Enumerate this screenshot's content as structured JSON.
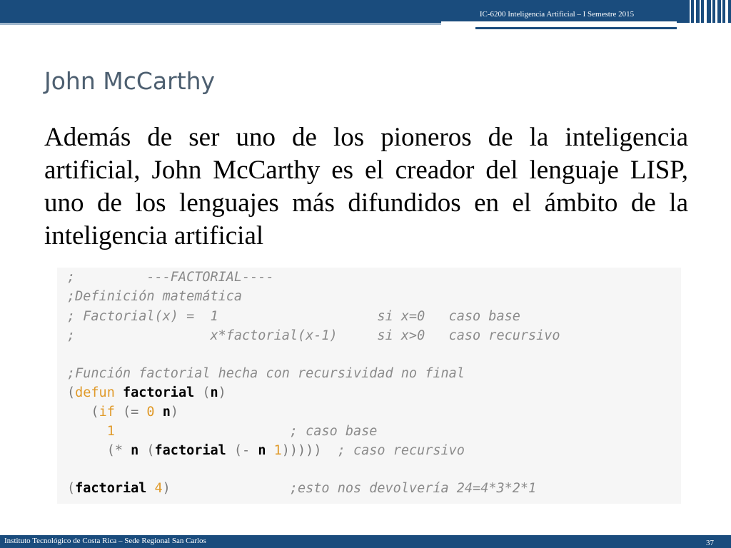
{
  "header": {
    "course": "IC-6200 Inteligencia Artificial – I Semestre 2015"
  },
  "slide": {
    "title": "John McCarthy",
    "paragraph": "Además de ser uno de los pioneros de la inteligencia artificial, John McCarthy es el creador del lenguaje LISP, uno de los lenguajes más difundidos en el ámbito de la inteligencia artificial"
  },
  "code": {
    "lines": [
      [
        {
          "t": ";         ---FACTORIAL----",
          "c": "c"
        }
      ],
      [
        {
          "t": ";Definición matemática",
          "c": "c"
        }
      ],
      [
        {
          "t": "; Factorial(x) =  1                    si x=0   caso base",
          "c": "c"
        }
      ],
      [
        {
          "t": ";                 x*factorial(x-1)     si x>0   caso recursivo",
          "c": "c"
        }
      ],
      [],
      [
        {
          "t": ";Función factorial hecha con recursividad no final",
          "c": "c"
        }
      ],
      [
        {
          "t": "(",
          "c": "p"
        },
        {
          "t": "defun",
          "c": "k"
        },
        {
          "t": " ",
          "c": "s"
        },
        {
          "t": "factorial",
          "c": "s"
        },
        {
          "t": " (",
          "c": "p"
        },
        {
          "t": "n",
          "c": "s"
        },
        {
          "t": ")",
          "c": "p"
        }
      ],
      [
        {
          "t": "   (",
          "c": "p"
        },
        {
          "t": "if",
          "c": "k"
        },
        {
          "t": " (= ",
          "c": "p"
        },
        {
          "t": "0",
          "c": "n"
        },
        {
          "t": " ",
          "c": "p"
        },
        {
          "t": "n",
          "c": "s"
        },
        {
          "t": ")",
          "c": "p"
        }
      ],
      [
        {
          "t": "     ",
          "c": "p"
        },
        {
          "t": "1",
          "c": "n"
        },
        {
          "t": "                      ; caso base",
          "c": "c"
        }
      ],
      [
        {
          "t": "     (* ",
          "c": "p"
        },
        {
          "t": "n",
          "c": "s"
        },
        {
          "t": " (",
          "c": "p"
        },
        {
          "t": "factorial",
          "c": "s"
        },
        {
          "t": " (- ",
          "c": "p"
        },
        {
          "t": "n",
          "c": "s"
        },
        {
          "t": " ",
          "c": "p"
        },
        {
          "t": "1",
          "c": "n"
        },
        {
          "t": ")))))  ",
          "c": "p"
        },
        {
          "t": "; caso recursivo",
          "c": "c"
        }
      ],
      [],
      [
        {
          "t": "(",
          "c": "p"
        },
        {
          "t": "factorial",
          "c": "s"
        },
        {
          "t": " ",
          "c": "p"
        },
        {
          "t": "4",
          "c": "n"
        },
        {
          "t": ")",
          "c": "p"
        },
        {
          "t": "               ;esto nos devolvería 24=4*3*2*1",
          "c": "c"
        }
      ]
    ]
  },
  "footer": {
    "institution": "Instituto Tecnológico de Costa Rica – Sede Regional San Carlos",
    "page": "37"
  }
}
